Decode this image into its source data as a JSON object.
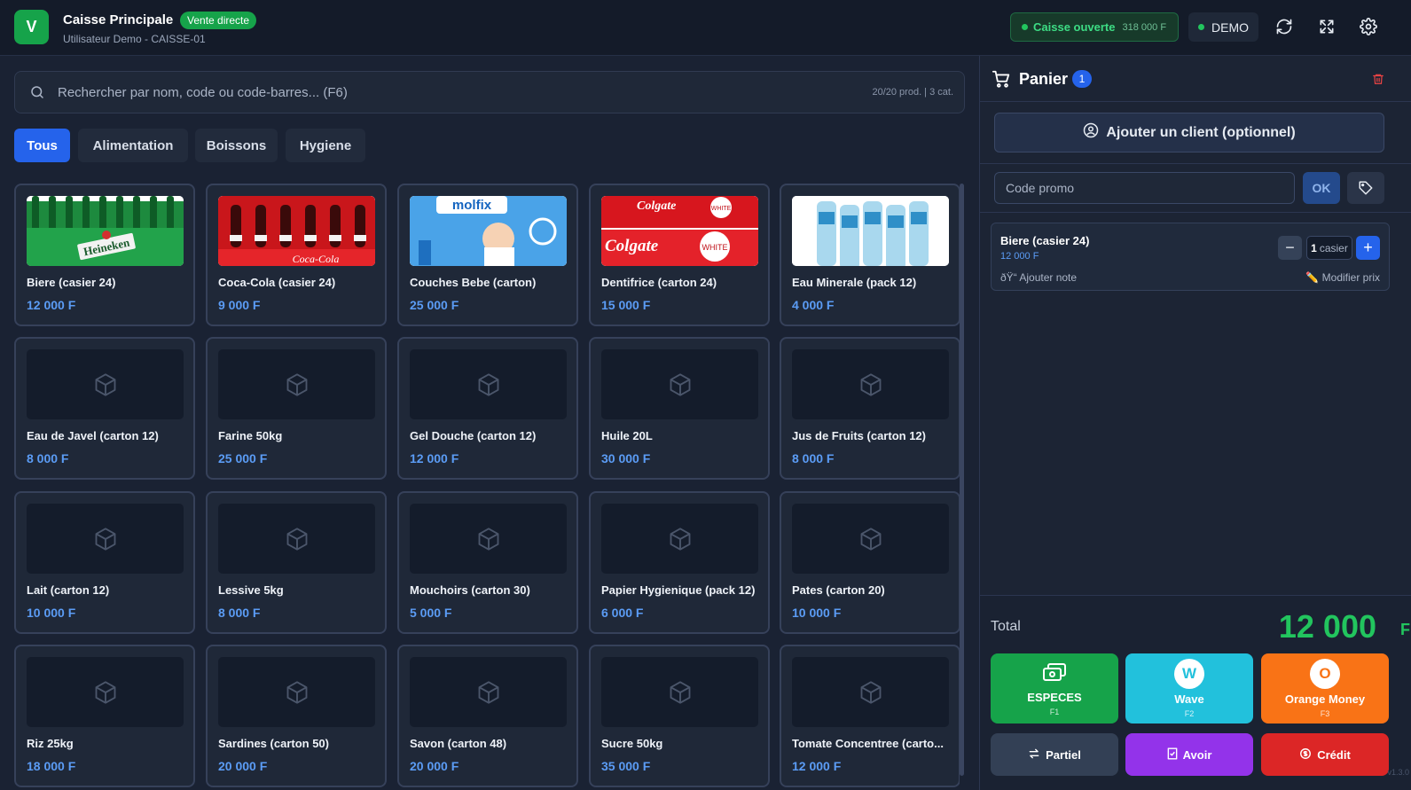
{
  "header": {
    "logo_letter": "V",
    "title": "Caisse Principale",
    "mode_badge": "Vente directe",
    "subtitle": "Utilisateur Demo - CAISSE-01",
    "caisse_status": "Caisse ouverte",
    "caisse_amount": "318 000 F",
    "demo_label": "DEMO"
  },
  "search": {
    "placeholder": "Rechercher par nom, code ou code-barres... (F6)",
    "meta": "20/20 prod.  |  3 cat."
  },
  "categories": [
    {
      "label": "Tous",
      "active": true
    },
    {
      "label": "Alimentation",
      "active": false
    },
    {
      "label": "Boissons",
      "active": false
    },
    {
      "label": "Hygiene",
      "active": false
    }
  ],
  "products": [
    {
      "name": "Biere (casier 24)",
      "price": "12 000 F",
      "image": "beer"
    },
    {
      "name": "Coca-Cola (casier 24)",
      "price": "9 000 F",
      "image": "cola"
    },
    {
      "name": "Couches Bebe (carton)",
      "price": "25 000 F",
      "image": "diapers"
    },
    {
      "name": "Dentifrice (carton 24)",
      "price": "15 000 F",
      "image": "toothpaste"
    },
    {
      "name": "Eau Minerale (pack 12)",
      "price": "4 000 F",
      "image": "water"
    },
    {
      "name": "Eau de Javel (carton 12)",
      "price": "8 000 F",
      "image": "box"
    },
    {
      "name": "Farine 50kg",
      "price": "25 000 F",
      "image": "box"
    },
    {
      "name": "Gel Douche (carton 12)",
      "price": "12 000 F",
      "image": "box"
    },
    {
      "name": "Huile 20L",
      "price": "30 000 F",
      "image": "box"
    },
    {
      "name": "Jus de Fruits (carton 12)",
      "price": "8 000 F",
      "image": "box"
    },
    {
      "name": "Lait (carton 12)",
      "price": "10 000 F",
      "image": "box"
    },
    {
      "name": "Lessive 5kg",
      "price": "8 000 F",
      "image": "box"
    },
    {
      "name": "Mouchoirs (carton 30)",
      "price": "5 000 F",
      "image": "box"
    },
    {
      "name": "Papier Hygienique (pack 12)",
      "price": "6 000 F",
      "image": "box"
    },
    {
      "name": "Pates (carton 20)",
      "price": "10 000 F",
      "image": "box"
    },
    {
      "name": "Riz 25kg",
      "price": "18 000 F",
      "image": "box"
    },
    {
      "name": "Sardines (carton 50)",
      "price": "20 000 F",
      "image": "box"
    },
    {
      "name": "Savon (carton 48)",
      "price": "20 000 F",
      "image": "box"
    },
    {
      "name": "Sucre 50kg",
      "price": "35 000 F",
      "image": "box"
    },
    {
      "name": "Tomate Concentree (carto...",
      "price": "12 000 F",
      "image": "box"
    }
  ],
  "cart": {
    "title": "Panier",
    "count": "1",
    "client_button": "Ajouter un client (optionnel)",
    "promo_placeholder": "Code promo",
    "promo_ok": "OK",
    "items": [
      {
        "name": "Biere (casier 24)",
        "price": "12 000 F",
        "qty": "1",
        "unit": "casier",
        "note": "ðŸ“ Ajouter note",
        "modify": "✏️ Modifier prix"
      }
    ],
    "total_label": "Total",
    "total_amount": "12 000",
    "currency": "F"
  },
  "payments": [
    {
      "label": "ESPECES",
      "key": "F1",
      "color": "#16a34a"
    },
    {
      "label": "Wave",
      "key": "F2",
      "color": "#22c1dc",
      "icon_letter": "W"
    },
    {
      "label": "Orange Money",
      "key": "F3",
      "color": "#f97316",
      "icon_letter": "O"
    }
  ],
  "secondary": [
    {
      "label": "Partiel",
      "color": "#334055"
    },
    {
      "label": "Avoir",
      "color": "#9333ea"
    },
    {
      "label": "Crédit",
      "color": "#dc2626"
    }
  ],
  "version": "v1.3.0"
}
